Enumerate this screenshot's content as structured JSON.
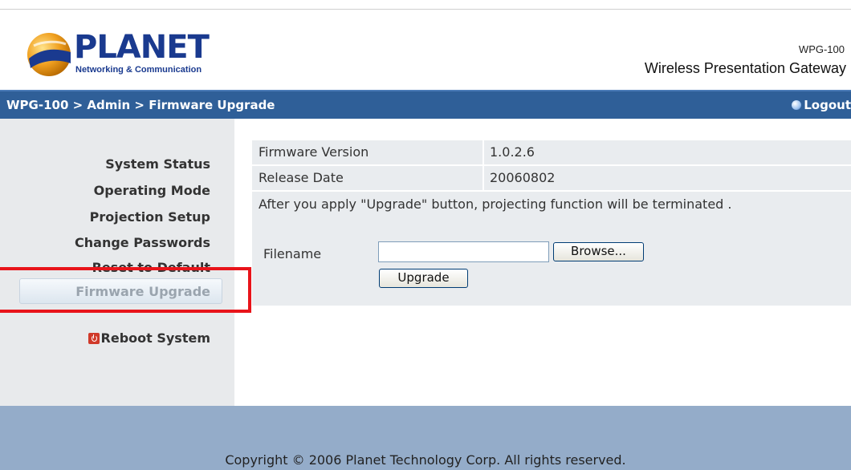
{
  "header": {
    "brand": "PLANET",
    "brand_tagline": "Networking & Communication",
    "model": "WPG-100",
    "product_name": "Wireless Presentation Gateway"
  },
  "navbar": {
    "breadcrumb": "WPG-100 > Admin > Firmware Upgrade",
    "logout_label": "Logout"
  },
  "sidebar": {
    "items": [
      {
        "label": "System Status"
      },
      {
        "label": "Operating Mode"
      },
      {
        "label": "Projection Setup"
      },
      {
        "label": "Change Passwords"
      },
      {
        "label": "Reset to Default"
      }
    ],
    "active_label": "Firmware Upgrade",
    "reboot_label": "Reboot System"
  },
  "firmware": {
    "version_label": "Firmware Version",
    "version_value": "1.0.2.6",
    "date_label": "Release Date",
    "date_value": "20060802",
    "warning": "After you apply \"Upgrade\" button, projecting function will be terminated .",
    "filename_label": "Filename",
    "filename_value": "",
    "browse_label": "Browse...",
    "upgrade_label": "Upgrade"
  },
  "footer": {
    "copyright": "Copyright © 2006 Planet Technology Corp. All rights reserved."
  },
  "colors": {
    "navbar": "#2f5f98",
    "footer": "#94acc9",
    "sidebar": "#e8eaec",
    "highlight": "#e8141a"
  }
}
